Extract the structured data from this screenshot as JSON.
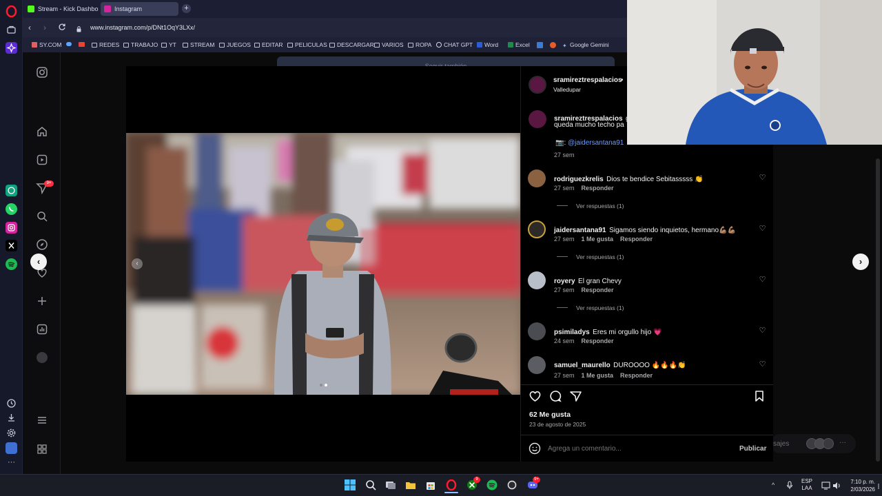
{
  "browser": {
    "tabs": [
      {
        "label": "Stream - Kick Dashboard",
        "icon": "kick-icon",
        "active": false
      },
      {
        "label": "Instagram",
        "icon": "instagram-icon",
        "active": true
      }
    ],
    "new_tab_glyph": "+",
    "url": "www.instagram.com/p/DNt1OqY3LXx/",
    "bookmarks": [
      "SY.COM",
      "REDES",
      "TRABAJO",
      "YT",
      "STREAM",
      "JUEGOS",
      "EDITAR",
      "PELICULAS",
      "DESCARGAR",
      "VARIOS",
      "ROPA",
      "CHAT GPT",
      "Word",
      "Excel",
      "Google Gemini"
    ],
    "sidebar_badge": "9+"
  },
  "instagram": {
    "follow_banner": "Seguir también",
    "post": {
      "author": "sramireztrespalacios",
      "author_dot": "•",
      "location": "Valledupar",
      "caption_user": "sramireztrespalacios",
      "caption_text_1": "gr",
      "caption_text_2": "queda mucho techo pa",
      "caption_mention_prefix": "📷:",
      "caption_mention": "@jaidersantana91",
      "caption_time": "27 sem",
      "likes": "62 Me gusta",
      "date": "23 de agosto de 2025",
      "comment_placeholder": "Agrega un comentario...",
      "publish_label": "Publicar"
    },
    "comments": [
      {
        "user": "rodriguezkrelis",
        "text": "Dios te bendice Sebitasssss 👏",
        "time": "27 sem",
        "likes": "",
        "reply": "Responder",
        "view_replies": "Ver respuestas (1)"
      },
      {
        "user": "jaidersantana91",
        "text": "Sigamos siendo inquietos, hermano💪🏽💪🏽",
        "time": "27 sem",
        "likes": "1 Me gusta",
        "reply": "Responder",
        "view_replies": "Ver respuestas (1)"
      },
      {
        "user": "royery",
        "text": "El gran Chevy",
        "time": "27 sem",
        "likes": "",
        "reply": "Responder",
        "view_replies": "Ver respuestas (1)"
      },
      {
        "user": "psimiladys",
        "text": "Eres mi orgullo hijo 💗",
        "time": "24 sem",
        "likes": "",
        "reply": "Responder",
        "view_replies": ""
      },
      {
        "user": "samuel_maurello",
        "text": "DUROOOO 🔥🔥🔥👏",
        "time": "27 sem",
        "likes": "1 Me gusta",
        "reply": "Responder",
        "view_replies": ""
      }
    ],
    "messages_label": "sajes",
    "messages_more": "···"
  },
  "taskbar": {
    "lang_top": "ESP",
    "lang_bottom": "LAA",
    "time": "7:10 p. m.",
    "date": "2/03/2026",
    "badge_opera": "9",
    "badge_discord": "9+"
  },
  "colors": {
    "accent_blue": "#6a9cff",
    "like_red": "#ff3040",
    "kick_green": "#53fc18",
    "opera_red": "#ff1b2d"
  }
}
